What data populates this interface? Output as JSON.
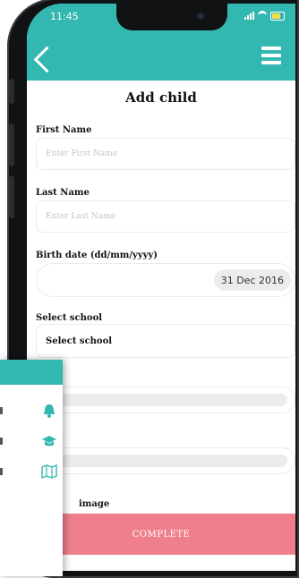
{
  "status_bar": {
    "time": "11:45"
  },
  "nav": {
    "back_icon": "chevron-left-icon",
    "menu_icon": "hamburger-menu-icon"
  },
  "page": {
    "title": "Add child"
  },
  "form": {
    "first_name": {
      "label": "First Name",
      "placeholder": "Enter First Name",
      "value": ""
    },
    "last_name": {
      "label": "Last Name",
      "placeholder": "Enter Last Name",
      "value": ""
    },
    "birth_date": {
      "label": "Birth date (dd/mm/yyyy)",
      "value": "31 Dec 2016"
    },
    "school": {
      "label": "Select school",
      "value": "Select school"
    },
    "image_label": "image"
  },
  "complete_button": {
    "label": "COMPLETE"
  },
  "side_panel": {
    "icons": [
      "bell-icon",
      "graduation-cap-icon",
      "map-icon"
    ]
  },
  "colors": {
    "accent": "#33b7b1",
    "button": "#f07f8c",
    "battery": "#f3dd4a"
  }
}
